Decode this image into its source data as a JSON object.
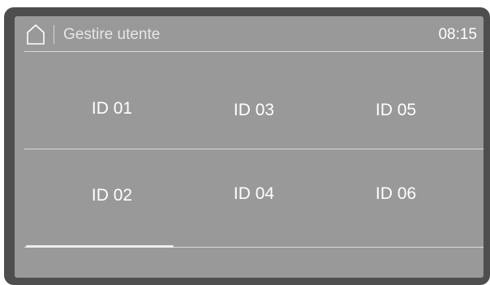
{
  "header": {
    "home_icon": "home-icon",
    "title": "Gestire utente",
    "time": "08:15"
  },
  "users": [
    {
      "label": "ID 01"
    },
    {
      "label": "ID 03"
    },
    {
      "label": "ID 05"
    },
    {
      "label": "ID 02"
    },
    {
      "label": "ID 04"
    },
    {
      "label": "ID 06"
    }
  ],
  "colors": {
    "bezel": "#4e4e4e",
    "screen": "#999999",
    "text": "#ffffff",
    "divider": "#d9d9d9"
  }
}
